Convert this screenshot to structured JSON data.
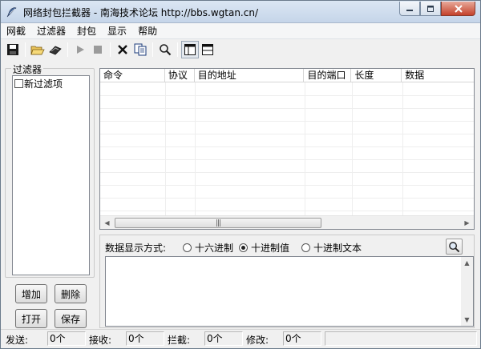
{
  "window": {
    "title": "网络封包拦截器 - 南海技术论坛 http://bbs.wgtan.cn/"
  },
  "menu": [
    "网截",
    "过滤器",
    "封包",
    "显示",
    "帮助"
  ],
  "toolbar": {
    "icons": [
      "save-icon",
      "open-folder-icon",
      "eraser-icon",
      "play-icon",
      "stop-icon",
      "delete-icon",
      "copy-icon",
      "search-icon",
      "layout-columns-icon",
      "layout-rows-icon"
    ]
  },
  "filters": {
    "group_label": "过滤器",
    "items": [
      {
        "label": "新过滤项",
        "checked": false
      }
    ],
    "buttons": {
      "add": "增加",
      "delete": "删除",
      "open": "打开",
      "save": "保存"
    }
  },
  "packet_list": {
    "columns": [
      "命令",
      "协议",
      "目的地址",
      "目的端口",
      "长度",
      "数据"
    ],
    "scroll_thumb_grip": "|||"
  },
  "data_view": {
    "mode_label": "数据显示方式:",
    "options": [
      {
        "label": "十六进制",
        "selected": false
      },
      {
        "label": "十进制值",
        "selected": true
      },
      {
        "label": "十进制文本",
        "selected": false
      }
    ]
  },
  "status": {
    "send_label": "发送:",
    "send_value": "0个",
    "recv_label": "接收:",
    "recv_value": "0个",
    "block_label": "拦截:",
    "block_value": "0个",
    "modify_label": "修改:",
    "modify_value": "0个"
  },
  "colors": {
    "titlebar": "#c5d5e9",
    "close_button": "#c4422b",
    "window_bg": "#f0f0f0"
  }
}
